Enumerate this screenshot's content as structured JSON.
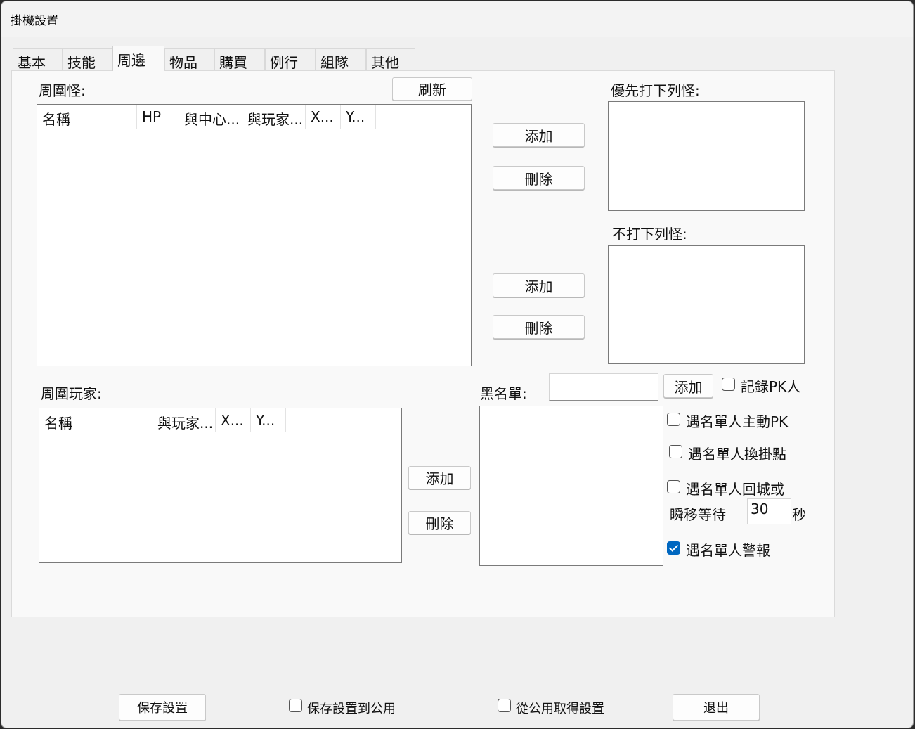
{
  "window": {
    "title": "掛機設置"
  },
  "tabs": [
    {
      "label": "基本"
    },
    {
      "label": "技能"
    },
    {
      "label": "周邊"
    },
    {
      "label": "物品"
    },
    {
      "label": "購買"
    },
    {
      "label": "例行"
    },
    {
      "label": "組隊"
    },
    {
      "label": "其他"
    }
  ],
  "active_tab": "周邊",
  "monsters": {
    "label": "周圍怪:",
    "refresh_label": "刷新",
    "columns": [
      "名稱",
      "HP",
      "與中心...",
      "與玩家...",
      "X...",
      "Y..."
    ],
    "rows": []
  },
  "priority": {
    "label": "優先打下列怪:",
    "add_label": "添加",
    "delete_label": "刪除",
    "items": []
  },
  "no_attack": {
    "label": "不打下列怪:",
    "add_label": "添加",
    "delete_label": "刪除",
    "items": []
  },
  "players": {
    "label": "周圍玩家:",
    "columns": [
      "名稱",
      "與玩家...",
      "X...",
      "Y..."
    ],
    "rows": [],
    "add_label": "添加",
    "delete_label": "刪除"
  },
  "blacklist": {
    "label": "黑名單:",
    "input_value": "",
    "add_label": "添加",
    "items": [],
    "record_pk": {
      "label": "記錄PK人",
      "checked": false
    },
    "auto_pk": {
      "label": "遇名單人主動PK",
      "checked": false
    },
    "switch_spot": {
      "label": "遇名單人換掛點",
      "checked": false
    },
    "return_town": {
      "label": "遇名單人回城或",
      "checked": false
    },
    "teleport_wait_label": "瞬移等待",
    "teleport_wait_value": "30",
    "teleport_wait_unit": "秒",
    "alarm": {
      "label": "遇名單人警報",
      "checked": true
    }
  },
  "footer": {
    "save_label": "保存設置",
    "save_public": {
      "label": "保存設置到公用",
      "checked": false
    },
    "load_public": {
      "label": "從公用取得設置",
      "checked": false
    },
    "exit_label": "退出"
  }
}
